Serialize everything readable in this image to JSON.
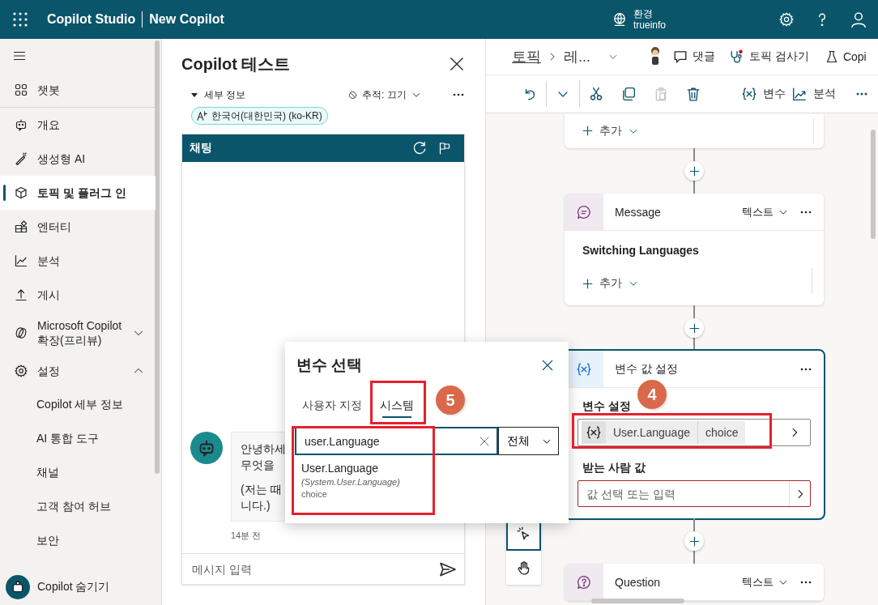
{
  "header": {
    "app_title": "Copilot Studio",
    "bot_name": "New Copilot",
    "environment_label": "환경",
    "environment_name": "trueinfo"
  },
  "sidebar": {
    "items": [
      {
        "label": "챗봇",
        "selected": false
      },
      {
        "label": "개요",
        "selected": false
      },
      {
        "label": "생성형 AI",
        "selected": false
      },
      {
        "label": "토픽 및 플러그 인",
        "selected": true
      },
      {
        "label": "엔터티",
        "selected": false
      },
      {
        "label": "분석",
        "selected": false
      },
      {
        "label": "게시",
        "selected": false
      },
      {
        "label": "Microsoft Copilot 확장(프리뷰)",
        "selected": false,
        "expanded": false
      },
      {
        "label": "설정",
        "selected": false,
        "expanded": true,
        "children": [
          {
            "label": "Copilot 세부 정보",
            "selected": false
          },
          {
            "label": "AI 통합 도구",
            "selected": false
          },
          {
            "label": "채널",
            "selected": false
          },
          {
            "label": "고객 참여 허브",
            "selected": false
          },
          {
            "label": "보안",
            "selected": false
          }
        ]
      }
    ],
    "footer": "Copilot 숨기기"
  },
  "test_panel": {
    "title": "Copilot 테스트",
    "details": "세부 정보",
    "tracking": "추적: 끄기",
    "language": "한국어(대한민국) (ko-KR)",
    "chat_title": "채팅",
    "message": {
      "paragraphs": [
        [
          "안녕하세",
          "무엇을"
        ],
        [
          "(저는 때",
          "니다.)"
        ]
      ],
      "time": "14분 전"
    },
    "input_placeholder": "메시지 입력"
  },
  "canvas": {
    "breadcrumb": [
      "토픽",
      "레..."
    ],
    "comments": "댓글",
    "checker": "토픽 검사기",
    "test": "Copi",
    "toolbar": [
      {
        "kind": "undo",
        "disabled": false
      },
      {
        "kind": "dropdown",
        "disabled": false
      },
      {
        "kind": "cut",
        "disabled": false
      },
      {
        "kind": "copy",
        "disabled": false
      },
      {
        "kind": "paste",
        "disabled": true
      },
      {
        "kind": "delete",
        "disabled": false
      },
      {
        "kind": "variables",
        "label": "변수",
        "disabled": false
      },
      {
        "kind": "analytics",
        "label": "분석",
        "disabled": false
      },
      {
        "kind": "more",
        "disabled": false
      }
    ],
    "nodes": [
      {
        "kind": "partial",
        "add_label": "추가"
      },
      {
        "kind": "message",
        "title": "Message",
        "type": "텍스트",
        "body": "Switching Languages",
        "add_label": "추가",
        "selected": false
      },
      {
        "kind": "set_variable",
        "title": "변수 값 설정",
        "field_label": "변수 설정",
        "variable": "User.Language",
        "variable_type": "choice",
        "value_label": "받는 사람 값",
        "value_placeholder": "값 선택 또는 입력",
        "selected": true
      },
      {
        "kind": "question",
        "title": "Question",
        "type": "텍스트",
        "selected": false
      }
    ],
    "tools": [
      {
        "kind": "pointer",
        "selected": true
      },
      {
        "kind": "hand",
        "selected": false
      }
    ]
  },
  "popup": {
    "title": "변수 선택",
    "tabs": [
      {
        "label": "사용자 지정",
        "selected": false
      },
      {
        "label": "시스템",
        "selected": true
      }
    ],
    "search_value": "user.Language",
    "filter": "전체",
    "results": [
      {
        "name": "User.Language",
        "path": "(System.User.Language)",
        "type": "choice"
      }
    ]
  },
  "annotations": [
    {
      "label": "5"
    },
    {
      "label": "4"
    }
  ]
}
